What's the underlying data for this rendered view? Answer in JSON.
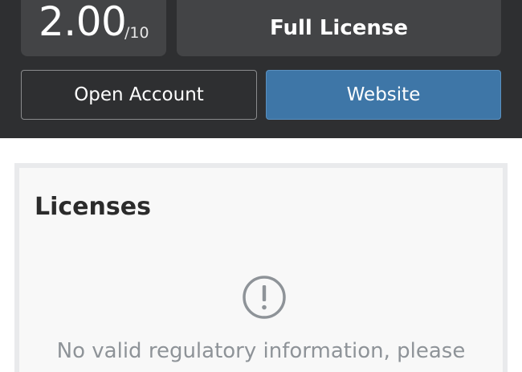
{
  "header": {
    "score": {
      "value": "2.00",
      "max": "/10"
    },
    "license_type": "Full License",
    "buttons": {
      "open_account": "Open Account",
      "website": "Website"
    }
  },
  "licenses_card": {
    "title": "Licenses",
    "icon": "exclamation-circle-icon",
    "notice": "No valid regulatory information, please"
  }
}
